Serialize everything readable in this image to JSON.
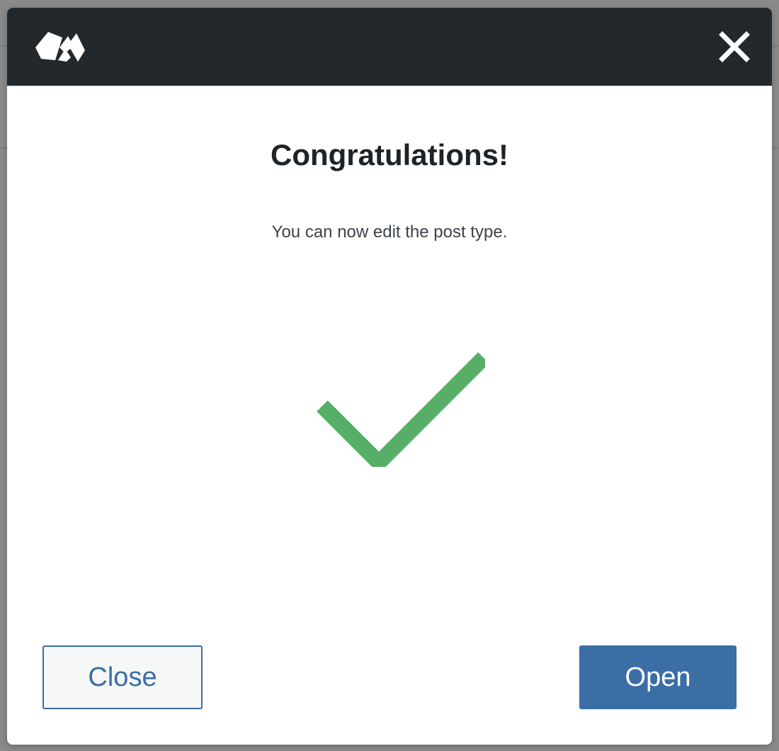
{
  "dialog": {
    "title": "Congratulations!",
    "message": "You can now edit the post type.",
    "close_button_label": "Close",
    "open_button_label": "Open"
  },
  "icons": {
    "logo": "toolset-logo-icon",
    "close": "close-icon",
    "success": "checkmark-icon"
  },
  "colors": {
    "header_bg": "#23282d",
    "checkmark": "#56ae67",
    "primary": "#3a6ea5",
    "title_text": "#1d2327"
  }
}
